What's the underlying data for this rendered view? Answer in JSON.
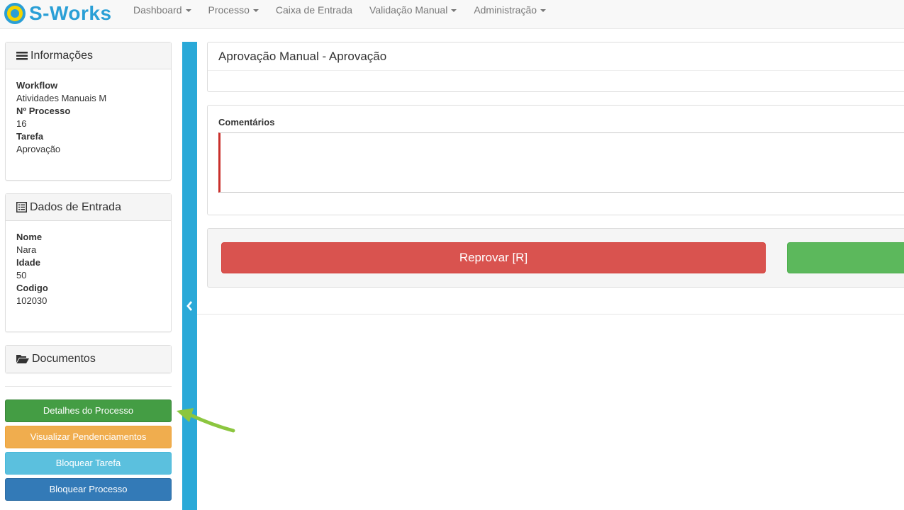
{
  "brand": {
    "name": "S-Works"
  },
  "nav": {
    "items": [
      {
        "label": "Dashboard",
        "dropdown": true
      },
      {
        "label": "Processo",
        "dropdown": true
      },
      {
        "label": "Caixa de Entrada",
        "dropdown": false
      },
      {
        "label": "Validação Manual",
        "dropdown": true
      },
      {
        "label": "Administração",
        "dropdown": true
      }
    ]
  },
  "info": {
    "title": "Informações",
    "icon": "list-icon",
    "fields": [
      {
        "label": "Workflow",
        "value": "Atividades Manuais M"
      },
      {
        "label": "Nº Processo",
        "value": "16"
      },
      {
        "label": "Tarefa",
        "value": "Aprovação"
      }
    ]
  },
  "input_data": {
    "title": "Dados de Entrada",
    "icon": "list-alt-icon",
    "fields": [
      {
        "label": "Nome",
        "value": "Nara"
      },
      {
        "label": "Idade",
        "value": "50"
      },
      {
        "label": "Codigo",
        "value": "102030"
      }
    ]
  },
  "documents": {
    "title": "Documentos",
    "icon": "folder-open-icon"
  },
  "side_buttons": {
    "details": "Detalhes do Processo",
    "pending": "Visualizar Pendenciamentos",
    "lock_task": "Bloquear Tarefa",
    "lock_process": "Bloquear Processo"
  },
  "main": {
    "title": "Aprovação Manual - Aprovação",
    "comments_label": "Comentários",
    "comments_value": "",
    "reject_label": "Reprovar [R]",
    "approve_label": ""
  },
  "colors": {
    "brand": "#2a9fd6",
    "collapse_bar": "#2aa9d8",
    "reject": "#d9534f",
    "approve": "#5cb85c",
    "details_button": "#449d44",
    "pending_button": "#f0ad4e",
    "lock_task_button": "#5bc0de",
    "lock_process_button": "#337ab7",
    "annotation_arrow": "#8cc63f"
  }
}
